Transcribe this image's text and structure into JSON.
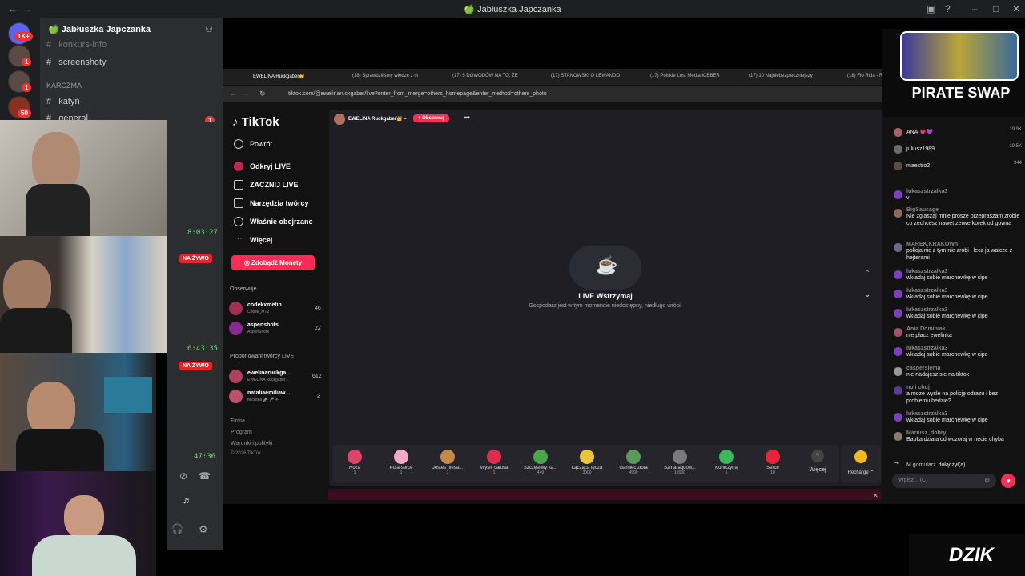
{
  "window": {
    "title": "🍏 Jabłuszka Japczanka"
  },
  "discord": {
    "server_name": "🍏 Jabłuszka Japczanka",
    "badges": [
      "1K+",
      "1",
      "1",
      "50"
    ],
    "channels": [
      {
        "name": "konkurs-info"
      },
      {
        "name": "screenshoty"
      },
      {
        "name": "KARCZMA"
      },
      {
        "name": "katyń"
      },
      {
        "name": "general"
      }
    ],
    "channel_badge": "1",
    "timestamps": [
      "8:03:27",
      "6:43:35",
      "47:36"
    ],
    "live_label": "NA ŻYWO"
  },
  "browser": {
    "tabs": [
      "EWELINA Ruckgaber👑",
      "(18) Sprawdziliśmy wiedzę z m",
      "(17) 5 DOWODÓW NA TO, ŻE",
      "(17) STANOWSKI O LEWANDO",
      "(17) Polskie Lost Media ICEBER",
      "(17) 10 Najniebezpieczniejszy",
      "(18) Flo Rida - Right Ro"
    ],
    "url": "tiktok.com/@ewelinaruckgaber/live?enter_from_merge=others_homepage&enter_method=others_photo"
  },
  "tiktok": {
    "logo": "TikTok",
    "back": "Powrót",
    "nav": [
      "Odkryj LIVE",
      "ZACZNIJ LIVE",
      "Narzędzia twórcy",
      "Właśnie obejrzane",
      "Więcej"
    ],
    "coins_button": "Zdobądź Monety",
    "following_header": "Obserwuje",
    "following": [
      {
        "name": "codekxmetin",
        "sub": "Codek_MT2",
        "count": "46"
      },
      {
        "name": "aspenshots",
        "sub": "AspenShots",
        "count": "22"
      }
    ],
    "suggested_header": "Proponowani twórcy LIVE",
    "suggested": [
      {
        "name": "ewelinaruckga...",
        "sub": "EWELINA Ruckgaber...",
        "count": "612"
      },
      {
        "name": "nataliaemiliaw...",
        "sub": "fleclstka 🚀 🎤 ✈",
        "count": "2"
      }
    ],
    "footer": [
      "Firma",
      "Program",
      "Warunki i polityki",
      "© 2026 TikTok"
    ],
    "streamer": "EWELINA Ruckgaber👑 –",
    "follow": "+ Obserwuj",
    "paused_title": "LIVE Wstrzymaj",
    "paused_sub": "Gospodarz jest w tym momencie niedostępny, niedługo wróci.",
    "gifts": [
      {
        "name": "Róża",
        "price": "1",
        "color": "#e0436a"
      },
      {
        "name": "Pufa-serce",
        "price": "1",
        "color": "#f3a9c9"
      },
      {
        "name": "Jesteś niesa...",
        "price": "1",
        "color": "#c58a4a"
      },
      {
        "name": "Wyślij całusa",
        "price": "1",
        "color": "#e02b4a"
      },
      {
        "name": "Szczęśliwy ka...",
        "price": "449",
        "color": "#4aa84a"
      },
      {
        "name": "Łącząca tęcza",
        "price": "3000",
        "color": "#e8c53a"
      },
      {
        "name": "Garniec złota",
        "price": "4999",
        "color": "#5a9a5a"
      },
      {
        "name": "Szmaragdow...",
        "price": "12000",
        "color": "#7a7a7a"
      },
      {
        "name": "Koniczyna",
        "price": "5",
        "color": "#3bb85a"
      },
      {
        "name": "Serce",
        "price": "10",
        "color": "#e8243a"
      }
    ],
    "more": "Więcej",
    "recharge": "Recharge ⌃",
    "top_viewers": [
      {
        "name": "ANA 💗💜",
        "score": "19.9K"
      },
      {
        "name": "juliusz1989",
        "score": "19.5K"
      },
      {
        "name": "maestro2",
        "score": "944"
      }
    ],
    "chat": [
      {
        "user": "lukaszstrzalka3",
        "msg": "v"
      },
      {
        "user": "BigSausage",
        "msg": "Nie zglaszaj mnie prosze przepraszam zrobie co zechcesz nawet zerwe korek od gowna"
      },
      {
        "user": "MAREK.KRAKOWn",
        "msg": "policja nic z tym nie zrobi . lecz ja walcze z hejterami"
      },
      {
        "user": "lukaszstrzalka3",
        "msg": "wkładaj sobie marchewkę w cipe"
      },
      {
        "user": "lukaszstrzalka3",
        "msg": "wkładaj sobie marchewkę w cipe"
      },
      {
        "user": "lukaszstrzalka3",
        "msg": "wkładaj sobie marchewkę w cipe"
      },
      {
        "user": "Ania Dominiak",
        "msg": "nie płacz ewelinka"
      },
      {
        "user": "lukaszstrzalka3",
        "msg": "wkładaj sobie marchewkę w cipe"
      },
      {
        "user": "caspersiema",
        "msg": "nie nadajesz sie na tiktok"
      },
      {
        "user": "no i chuj",
        "msg": "a moze wyślę na policję odrazu i bez problemu bedzie?"
      },
      {
        "user": "lukaszstrzalka3",
        "msg": "wkładaj sobie marchewkę w cipe"
      },
      {
        "user": "Mariusz_dobry",
        "msg": "Babka działa od wczoraj w necie chyba"
      }
    ],
    "joined_user": "M.gomularz",
    "joined_text": "dołączył(a)",
    "input_placeholder": "Wpisz... (C)"
  },
  "overlays": {
    "pirate": "PIRATE SWAP",
    "dzik": "DZIK"
  }
}
